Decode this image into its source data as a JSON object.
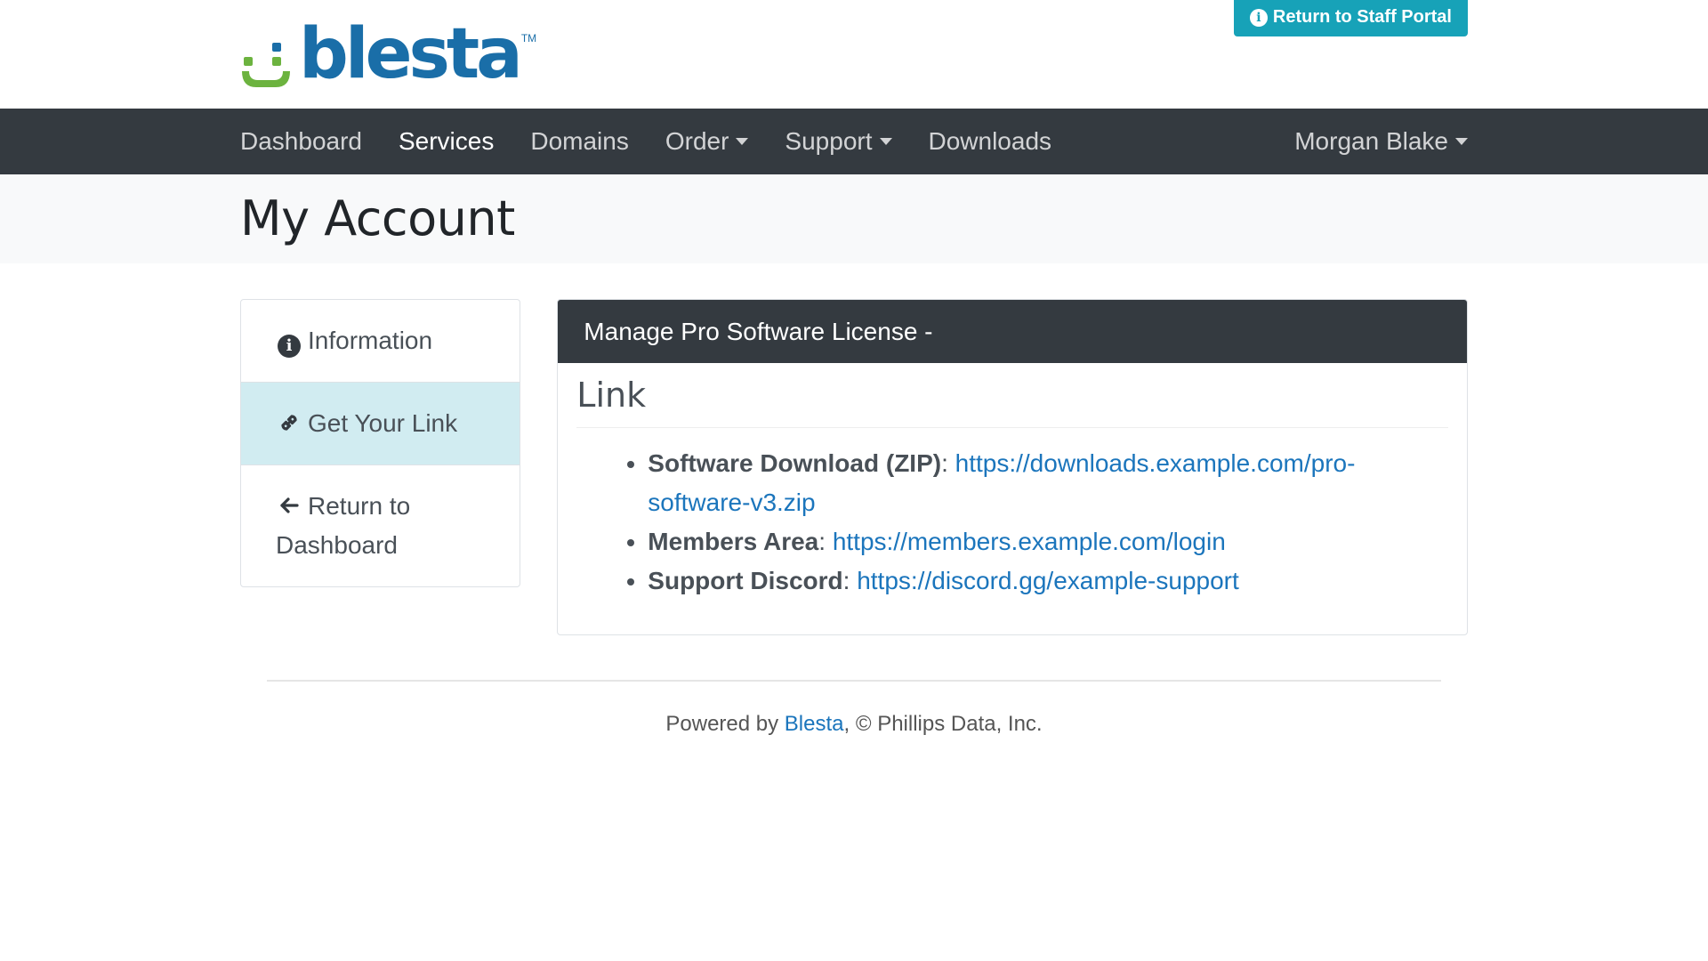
{
  "header": {
    "logo_text": "blesta",
    "logo_tm": "TM",
    "staff_portal_label": "Return to Staff Portal",
    "colors": {
      "logo_blue": "#1a6ea8",
      "logo_green": "#6cb33f",
      "staff_button": "#17a2b8"
    }
  },
  "nav": {
    "items": [
      {
        "label": "Dashboard"
      },
      {
        "label": "Services"
      },
      {
        "label": "Domains"
      },
      {
        "label": "Order"
      },
      {
        "label": "Support"
      },
      {
        "label": "Downloads"
      }
    ],
    "user": "Morgan Blake"
  },
  "page": {
    "title": "My Account"
  },
  "sidebar": {
    "items": [
      {
        "label": "Information",
        "icon": "info-circle-icon"
      },
      {
        "label": "Get Your Link",
        "icon": "link-icon"
      },
      {
        "label": "Return to Dashboard",
        "icon": "arrow-left-icon"
      }
    ]
  },
  "panel": {
    "heading": "Manage Pro Software License -",
    "section_title": "Link",
    "links": [
      {
        "label": "Software Download (ZIP)",
        "url": "https://downloads.example.com/pro-software-v3.zip"
      },
      {
        "label": "Members Area",
        "url": "https://members.example.com/login"
      },
      {
        "label": "Support Discord",
        "url": "https://discord.gg/example-support"
      }
    ]
  },
  "footer": {
    "powered_by": "Powered by",
    "brand_link": "Blesta",
    "copyright": ", © Phillips Data, Inc."
  }
}
